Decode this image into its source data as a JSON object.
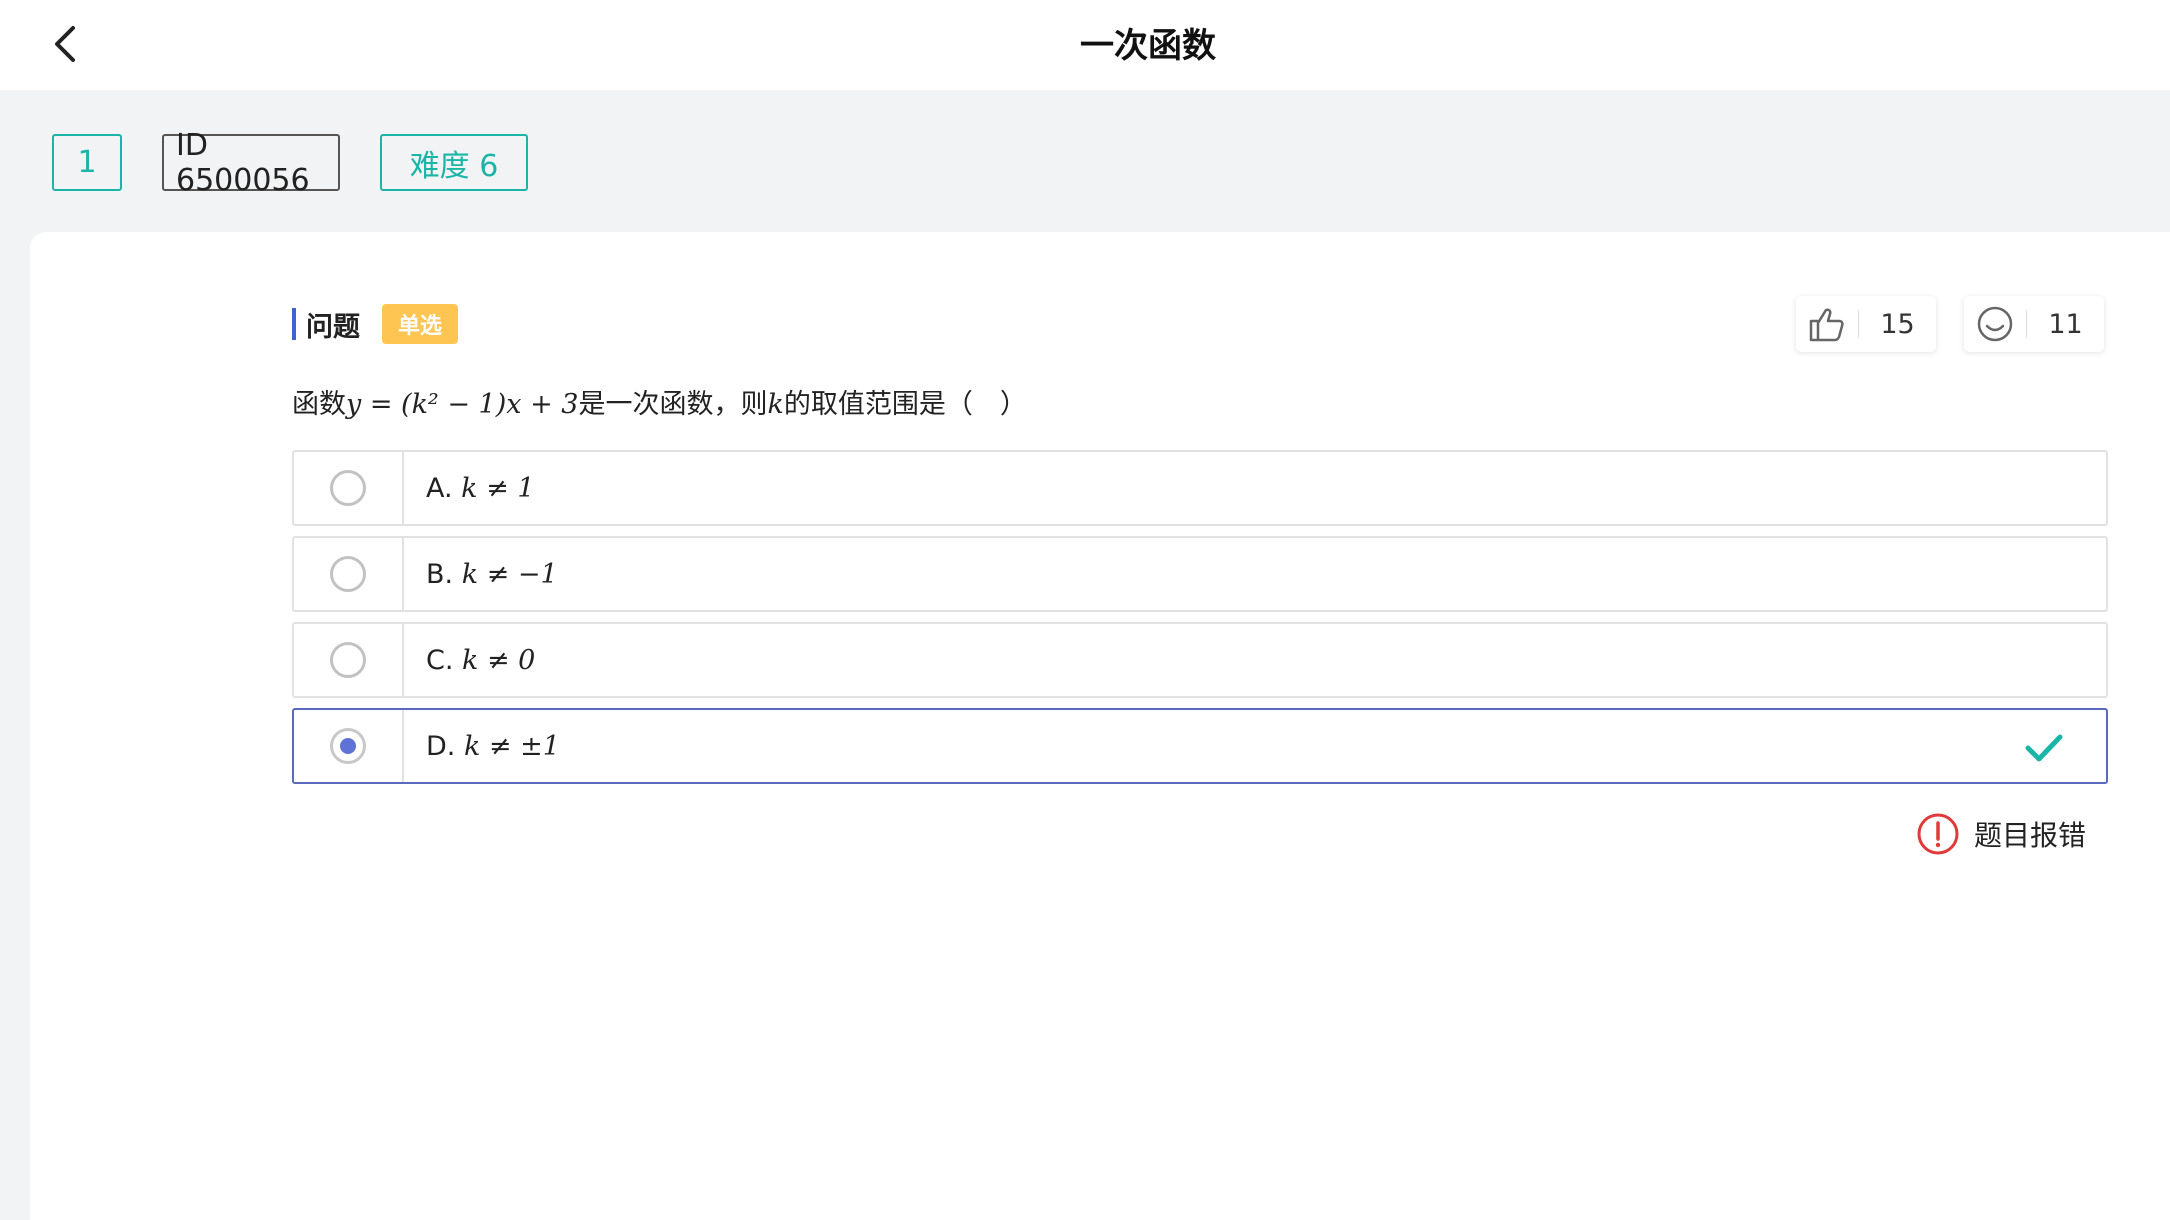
{
  "header": {
    "title": "一次函数"
  },
  "tags": {
    "number": "1",
    "id": "ID 6500056",
    "difficulty": "难度 6"
  },
  "question": {
    "section_label": "问题",
    "type_badge": "单选",
    "stem_prefix": "函数",
    "stem_math": "y = (k² − 1)x + 3",
    "stem_suffix_1": "是一次函数，则",
    "stem_var": "k",
    "stem_suffix_2": "的取值范围是（　）",
    "likes": "15",
    "comments": "11"
  },
  "options": [
    {
      "letter": "A.",
      "math": "k ≠ 1",
      "selected": false
    },
    {
      "letter": "B.",
      "math": "k ≠ −1",
      "selected": false
    },
    {
      "letter": "C.",
      "math": "k ≠ 0",
      "selected": false
    },
    {
      "letter": "D.",
      "math": "k ≠ ±1",
      "selected": true,
      "correct": true
    }
  ],
  "report": {
    "label": "题目报错"
  },
  "colors": {
    "accent": "#1bb5a8",
    "badge": "#ffc552",
    "selected": "#5969bd",
    "error": "#e03a3a"
  },
  "icons": [
    "back-arrow-icon",
    "thumbs-up-icon",
    "smiley-icon",
    "checkmark-icon",
    "exclamation-circle-icon"
  ]
}
